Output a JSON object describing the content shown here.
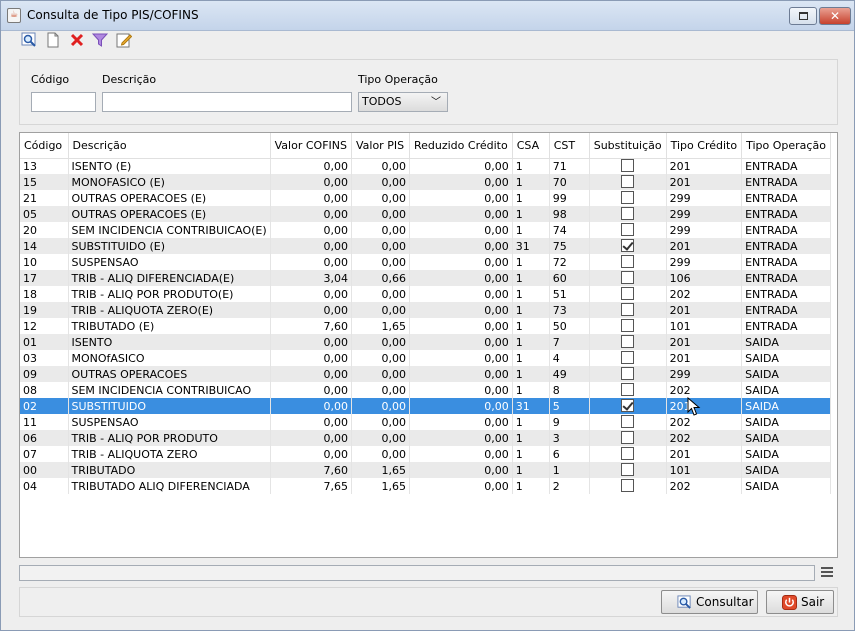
{
  "window": {
    "title": "Consulta de Tipo PIS/COFINS"
  },
  "toolbar": {
    "icons": [
      "search-icon",
      "new-document-icon",
      "delete-icon",
      "filter-icon",
      "edit-icon"
    ]
  },
  "filters": {
    "codigo_label": "Código",
    "codigo_value": "",
    "descricao_label": "Descrição",
    "descricao_value": "",
    "tipo_operacao_label": "Tipo Operação",
    "tipo_operacao_value": "TODOS"
  },
  "table": {
    "columns": [
      "Código",
      "Descrição",
      "Valor COFINS",
      "Valor PIS",
      "Reduzido Crédito",
      "CSA",
      "CST",
      "Substituição",
      "Tipo Crédito",
      "Tipo Operação"
    ],
    "selected_index": 15,
    "rows": [
      [
        "13",
        "ISENTO (E)",
        "0,00",
        "0,00",
        "0,00",
        "1",
        "71",
        false,
        "201",
        "ENTRADA"
      ],
      [
        "15",
        "MONOFASICO (E)",
        "0,00",
        "0,00",
        "0,00",
        "1",
        "70",
        false,
        "201",
        "ENTRADA"
      ],
      [
        "21",
        "OUTRAS OPERACOES (E)",
        "0,00",
        "0,00",
        "0,00",
        "1",
        "99",
        false,
        "299",
        "ENTRADA"
      ],
      [
        "05",
        "OUTRAS OPERACOES (E)",
        "0,00",
        "0,00",
        "0,00",
        "1",
        "98",
        false,
        "299",
        "ENTRADA"
      ],
      [
        "20",
        "SEM INCIDENCIA CONTRIBUICAO(E)",
        "0,00",
        "0,00",
        "0,00",
        "1",
        "74",
        false,
        "299",
        "ENTRADA"
      ],
      [
        "14",
        "SUBSTITUIDO (E)",
        "0,00",
        "0,00",
        "0,00",
        "31",
        "75",
        true,
        "201",
        "ENTRADA"
      ],
      [
        "10",
        "SUSPENSAO",
        "0,00",
        "0,00",
        "0,00",
        "1",
        "72",
        false,
        "299",
        "ENTRADA"
      ],
      [
        "17",
        "TRIB - ALIQ DIFERENCIADA(E)",
        "3,04",
        "0,66",
        "0,00",
        "1",
        "60",
        false,
        "106",
        "ENTRADA"
      ],
      [
        "18",
        "TRIB - ALIQ POR PRODUTO(E)",
        "0,00",
        "0,00",
        "0,00",
        "1",
        "51",
        false,
        "202",
        "ENTRADA"
      ],
      [
        "19",
        "TRIB - ALIQUOTA ZERO(E)",
        "0,00",
        "0,00",
        "0,00",
        "1",
        "73",
        false,
        "201",
        "ENTRADA"
      ],
      [
        "12",
        "TRIBUTADO (E)",
        "7,60",
        "1,65",
        "0,00",
        "1",
        "50",
        false,
        "101",
        "ENTRADA"
      ],
      [
        "01",
        "ISENTO",
        "0,00",
        "0,00",
        "0,00",
        "1",
        "7",
        false,
        "201",
        "SAIDA"
      ],
      [
        "03",
        "MONOfASICO",
        "0,00",
        "0,00",
        "0,00",
        "1",
        "4",
        false,
        "201",
        "SAIDA"
      ],
      [
        "09",
        "OUTRAS OPERACOES",
        "0,00",
        "0,00",
        "0,00",
        "1",
        "49",
        false,
        "299",
        "SAIDA"
      ],
      [
        "08",
        "SEM INCIDENCIA CONTRIBUICAO",
        "0,00",
        "0,00",
        "0,00",
        "1",
        "8",
        false,
        "202",
        "SAIDA"
      ],
      [
        "02",
        "SUBSTITUIDO",
        "0,00",
        "0,00",
        "0,00",
        "31",
        "5",
        true,
        "201",
        "SAIDA"
      ],
      [
        "11",
        "SUSPENSAO",
        "0,00",
        "0,00",
        "0,00",
        "1",
        "9",
        false,
        "202",
        "SAIDA"
      ],
      [
        "06",
        "TRIB - ALIQ POR PRODUTO",
        "0,00",
        "0,00",
        "0,00",
        "1",
        "3",
        false,
        "202",
        "SAIDA"
      ],
      [
        "07",
        "TRIB - ALIQUOTA ZERO",
        "0,00",
        "0,00",
        "0,00",
        "1",
        "6",
        false,
        "201",
        "SAIDA"
      ],
      [
        "00",
        "TRIBUTADO",
        "7,60",
        "1,65",
        "0,00",
        "1",
        "1",
        false,
        "101",
        "SAIDA"
      ],
      [
        "04",
        "TRIBUTADO ALIQ DIFERENCIADA",
        "7,65",
        "1,65",
        "0,00",
        "1",
        "2",
        false,
        "202",
        "SAIDA"
      ]
    ]
  },
  "status": {
    "text": ""
  },
  "buttons": {
    "consultar": "Consultar",
    "sair": "Sair"
  },
  "colors": {
    "selection": "#3a8ee0",
    "stripe": "#eaeaea",
    "close": "#c7412d"
  }
}
